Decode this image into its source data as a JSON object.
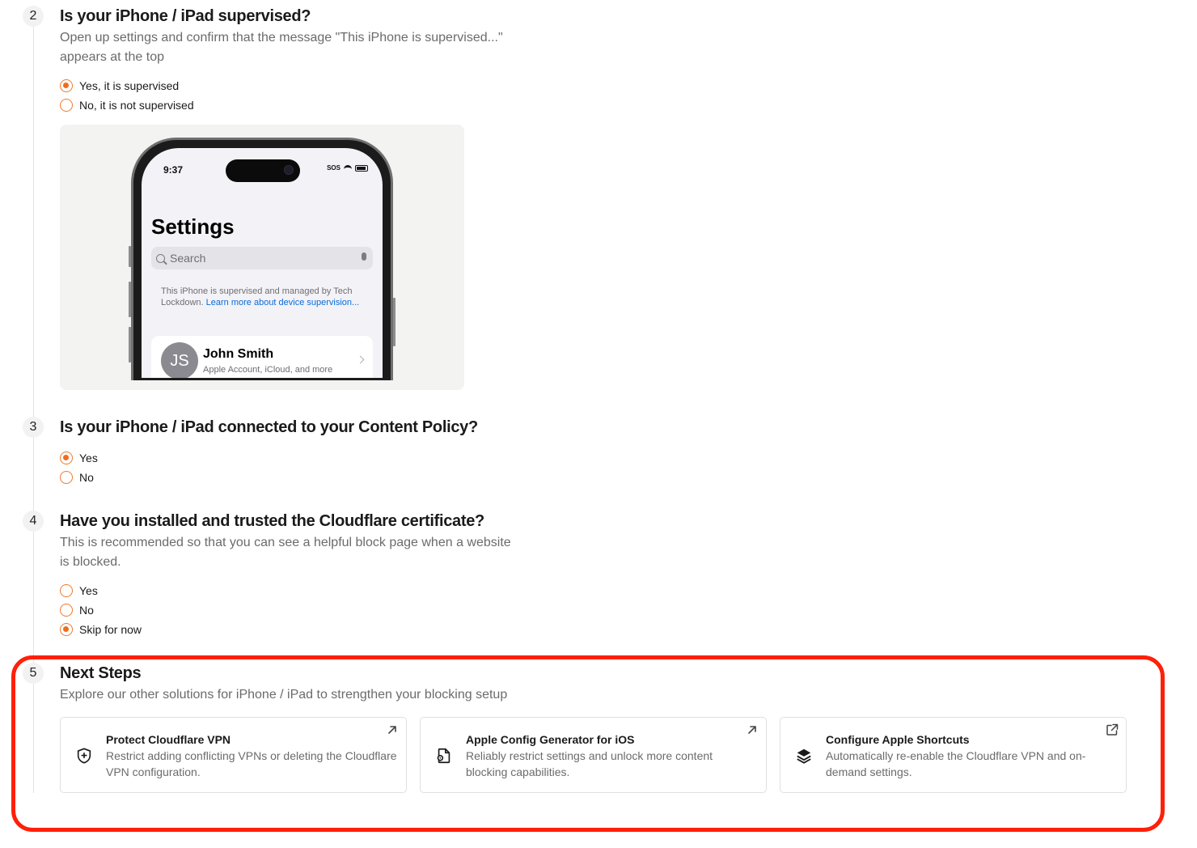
{
  "steps": [
    {
      "number": "2",
      "title": "Is your iPhone / iPad supervised?",
      "description": "Open up settings and confirm that the message \"This iPhone is supervised...\" appears at the top",
      "options": [
        {
          "label": "Yes, it is supervised",
          "checked": true
        },
        {
          "label": "No, it is not supervised",
          "checked": false
        }
      ]
    },
    {
      "number": "3",
      "title": "Is your iPhone / iPad connected to your Content Policy?",
      "options": [
        {
          "label": "Yes",
          "checked": true
        },
        {
          "label": "No",
          "checked": false
        }
      ]
    },
    {
      "number": "4",
      "title": "Have you installed and trusted the Cloudflare certificate?",
      "description": "This is recommended so that you can see a helpful block page when a website is blocked.",
      "options": [
        {
          "label": "Yes",
          "checked": false
        },
        {
          "label": "No",
          "checked": false
        },
        {
          "label": "Skip for now",
          "checked": true
        }
      ]
    },
    {
      "number": "5",
      "title": "Next Steps",
      "description": "Explore our other solutions for iPhone / iPad to strengthen your blocking setup"
    }
  ],
  "phone": {
    "time": "9:37",
    "status_text": "SOS",
    "screen_title": "Settings",
    "search_placeholder": "Search",
    "note_text": "This iPhone is supervised and managed by Tech Lockdown.",
    "note_link": "Learn more about device supervision...",
    "avatar_initials": "JS",
    "profile_name": "John Smith",
    "profile_subtitle": "Apple Account, iCloud, and more"
  },
  "cards": [
    {
      "title": "Protect Cloudflare VPN",
      "description": "Restrict adding conflicting VPNs or deleting the Cloudflare VPN configuration.",
      "icon": "shield-plus-icon",
      "corner_icon": "arrow-up-right-icon"
    },
    {
      "title": "Apple Config Generator for iOS",
      "description": "Reliably restrict settings and unlock more content blocking capabilities.",
      "icon": "file-gear-icon",
      "corner_icon": "arrow-up-right-icon"
    },
    {
      "title": "Configure Apple Shortcuts",
      "description": "Automatically re-enable the Cloudflare VPN and on-demand settings.",
      "icon": "layers-icon",
      "corner_icon": "external-link-icon"
    }
  ],
  "colors": {
    "accent": "#ef6c1e",
    "highlight": "#ff200a"
  }
}
